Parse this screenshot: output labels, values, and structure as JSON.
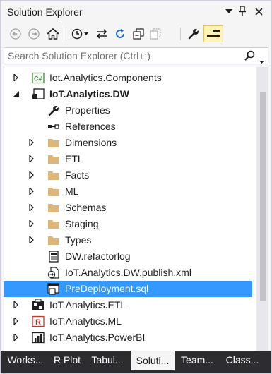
{
  "window": {
    "title": "Solution Explorer"
  },
  "search": {
    "placeholder": "Search Solution Explorer (Ctrl+;)"
  },
  "tree": {
    "items": [
      {
        "label": "Iot.Analytics.Components"
      },
      {
        "label": "IoT.Analytics.DW"
      },
      {
        "label": "Properties"
      },
      {
        "label": "References"
      },
      {
        "label": "Dimensions"
      },
      {
        "label": "ETL"
      },
      {
        "label": "Facts"
      },
      {
        "label": "ML"
      },
      {
        "label": "Schemas"
      },
      {
        "label": "Staging"
      },
      {
        "label": "Types"
      },
      {
        "label": "DW.refactorlog"
      },
      {
        "label": "IoT.Analytics.DW.publish.xml"
      },
      {
        "label": "PreDeployment.sql"
      },
      {
        "label": "IoT.Analytics.ETL"
      },
      {
        "label": "IoT.Analytics.ML"
      },
      {
        "label": "IoT.Analytics.PowerBI"
      }
    ]
  },
  "tabs": [
    {
      "label": "Works..."
    },
    {
      "label": "R Plot"
    },
    {
      "label": "Tabul..."
    },
    {
      "label": "Soluti..."
    },
    {
      "label": "Team..."
    },
    {
      "label": "Class..."
    }
  ],
  "colors": {
    "selection": "#3399ff",
    "folder": "#dcb67a",
    "accent_toggle": "#fff3b8"
  }
}
